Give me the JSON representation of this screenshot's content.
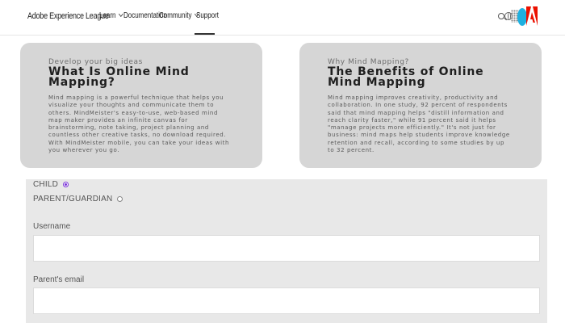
{
  "header": {
    "brand": "Adobe Experience League",
    "nav": [
      {
        "label": "Learn",
        "has_dropdown": true
      },
      {
        "label": "Documentation",
        "has_dropdown": false
      },
      {
        "label": "Community",
        "has_dropdown": true
      },
      {
        "label": "Support",
        "has_dropdown": false,
        "active": true
      }
    ],
    "icons": [
      "search-icon",
      "globe-icon",
      "apps-icon",
      "avatar",
      "adobe-logo-icon"
    ],
    "avatar_color": "#1eb0e0",
    "logo_color": "#eb1000"
  },
  "cards": [
    {
      "eyebrow": "Develop your big ideas",
      "title": "What Is Online Mind Mapping?",
      "body": "Mind mapping is a powerful technique that helps you visualize your thoughts and communicate them to others. MindMeister's easy-to-use, web-based mind map maker provides an infinite canvas for brainstorming, note taking, project planning and countless other creative tasks, no download required. With MindMeister mobile, you can take your ideas with you wherever you go."
    },
    {
      "eyebrow": "Why Mind Mapping?",
      "title": "The Benefits of Online Mind Mapping",
      "body": "Mind mapping improves creativity, productivity and collaboration. In one study, 92 percent of respondents said that mind mapping helps \"distill information and reach clarity faster,\" while 91 percent said it helps \"manage projects more efficiently.\" It's not just for business: mind maps help students improve knowledge retention and recall, according to some studies by up to 32 percent."
    }
  ],
  "form": {
    "role_options": [
      {
        "label": "CHILD",
        "selected": true
      },
      {
        "label": "PARENT/GUARDIAN",
        "selected": false
      }
    ],
    "username": {
      "label": "Username",
      "value": ""
    },
    "parent_email": {
      "label": "Parent's email",
      "value": ""
    },
    "accent_color": "#7b35d8"
  }
}
